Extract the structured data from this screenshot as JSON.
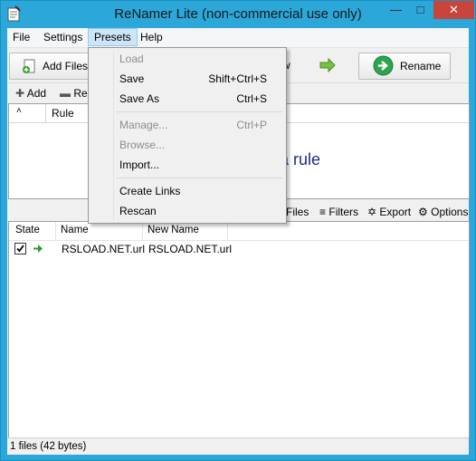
{
  "window": {
    "title": "ReNamer Lite (non-commercial use only)",
    "min_icon": "minimize-icon",
    "max_icon": "maximize-icon",
    "close_icon": "close-icon"
  },
  "menu": {
    "items": [
      "File",
      "Settings",
      "Presets",
      "Help"
    ],
    "active": "Presets"
  },
  "toolbar": {
    "add_files": "Add Files",
    "partial_label": "w",
    "rename": "Rename"
  },
  "rules": {
    "add": "Add",
    "remove_partial": "Rem",
    "header_sort": "˄",
    "header_rule": "Rule",
    "hint": "a rule"
  },
  "files_bar": {
    "files": "Files",
    "filters": "Filters",
    "export": "Export",
    "options": "Options"
  },
  "files": {
    "headers": {
      "state": "State",
      "name": "Name",
      "new_name": "New Name"
    },
    "rows": [
      {
        "name": "RSLOAD.NET.url",
        "new_name": "RSLOAD.NET.url",
        "checked": true
      }
    ]
  },
  "status": {
    "text": "1 files (42 bytes)"
  },
  "presets_menu": {
    "load": "Load",
    "save": "Save",
    "save_shortcut": "Shift+Ctrl+S",
    "save_as": "Save As",
    "save_as_shortcut": "Ctrl+S",
    "manage": "Manage...",
    "manage_shortcut": "Ctrl+P",
    "browse": "Browse...",
    "import": "Import...",
    "create_links": "Create Links",
    "rescan": "Rescan"
  },
  "colors": {
    "titlebar": "#2ba7d9",
    "close": "#c7453b",
    "hint": "#1f2a8a",
    "menu_highlight": "#cce4f7"
  }
}
